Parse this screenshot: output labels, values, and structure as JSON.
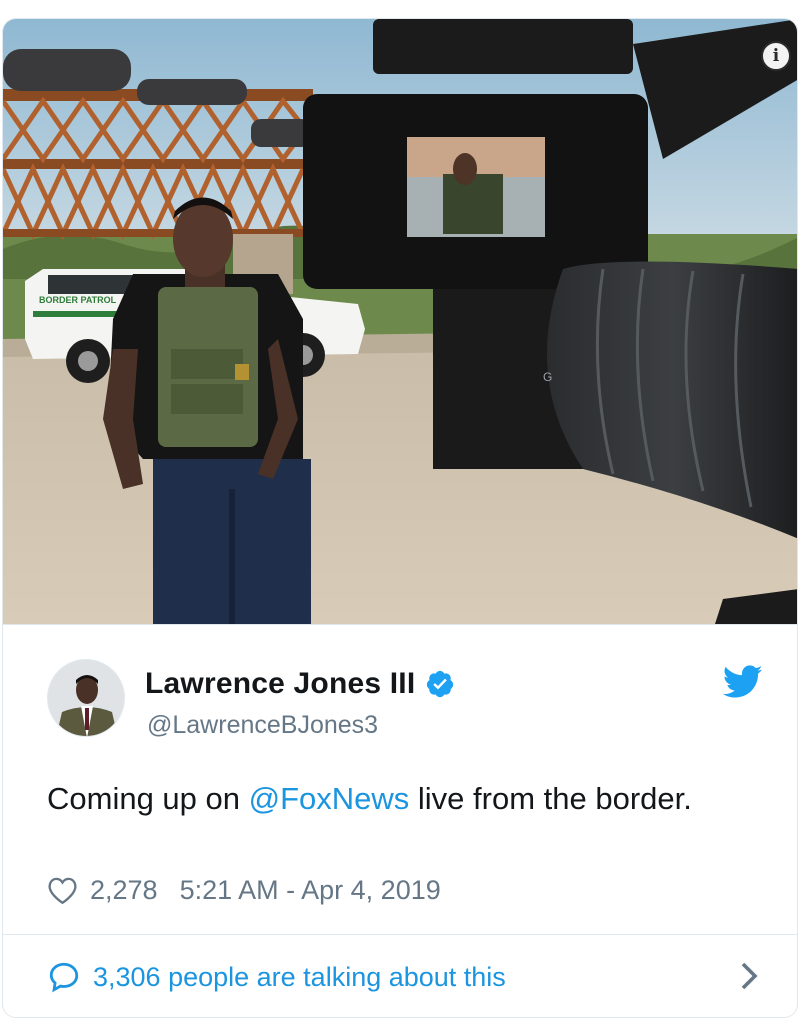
{
  "photo": {
    "vehicle_text": "BORDER PATROL",
    "monitor_mark": "G",
    "info_icon": "i"
  },
  "author": {
    "name": "Lawrence Jones III",
    "handle": "@LawrenceBJones3",
    "verified": true
  },
  "tweet": {
    "text_before": "Coming up on ",
    "mention": "@FoxNews",
    "text_after": " live from the border."
  },
  "meta": {
    "likes": "2,278",
    "timestamp": "5:21 AM - Apr 4, 2019"
  },
  "footer": {
    "talking": "3,306 people are talking about this"
  },
  "icons": {
    "verified": "verified-badge-icon",
    "platform": "twitter-bird-icon",
    "like": "heart-icon",
    "reply": "chat-bubble-icon",
    "more": "chevron-right-icon"
  },
  "colors": {
    "link": "#1b95e0",
    "muted": "#657786",
    "text": "#14171a",
    "border": "#e1e8ed"
  }
}
